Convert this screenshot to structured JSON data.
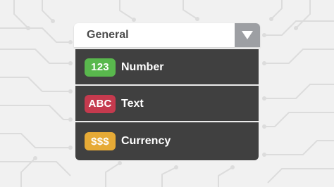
{
  "dropdown": {
    "selected_label": "General",
    "toggle_icon": "triangle-down-icon",
    "items": [
      {
        "badge": "123",
        "label": "Number",
        "badge_color": "#59b84d"
      },
      {
        "badge": "ABC",
        "label": "Text",
        "badge_color": "#c53a4e"
      },
      {
        "badge": "$$$",
        "label": "Currency",
        "badge_color": "#e6aa36"
      }
    ]
  },
  "colors": {
    "background": "#f1f1f1",
    "circuit_lines": "#dcdcdc",
    "menu_background": "#404040",
    "toggle_background": "#9d9fa3"
  }
}
